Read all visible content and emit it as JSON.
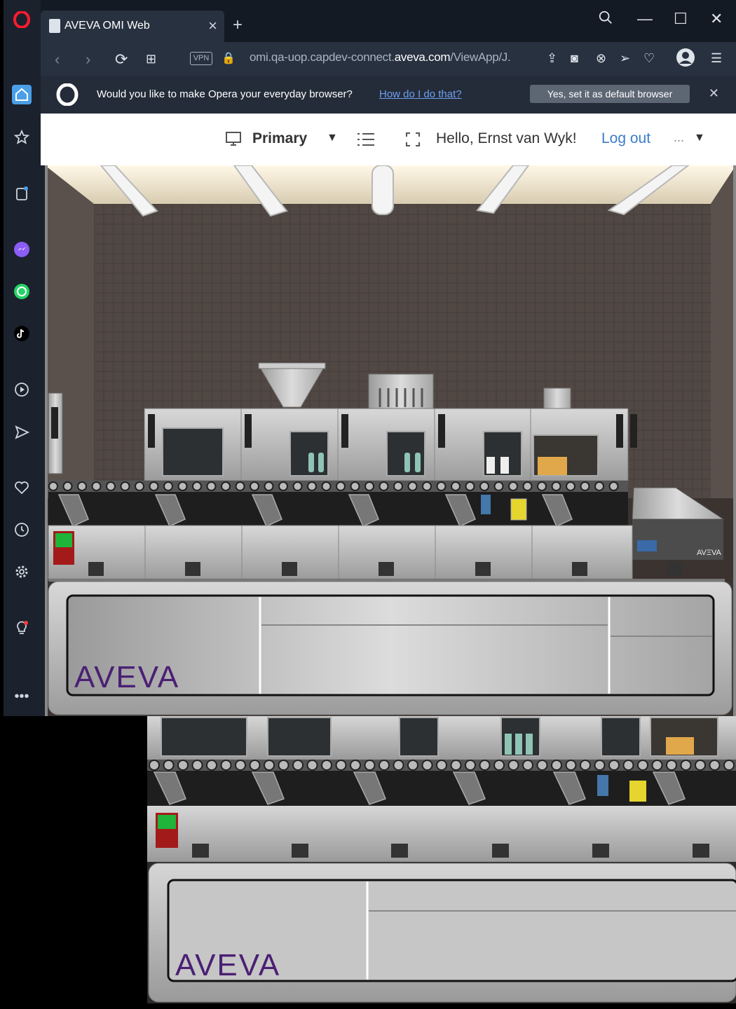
{
  "browser": {
    "tab_title": "AVEVA OMI Web",
    "url_prefix": "omi.qa-uop.capdev-connect.",
    "url_domain": "aveva.com",
    "url_suffix": "/ViewApp/J.",
    "vpn_label": "VPN",
    "banner_text": "Would you like to make Opera your everyday browser?",
    "banner_link": "How do I do that?",
    "banner_button": "Yes, set it as default browser"
  },
  "omi": {
    "screen_selector": "Primary",
    "greeting": "Hello, Ernst van Wyk!",
    "logout": "Log out",
    "more": "..."
  },
  "scene": {
    "brand": "AVEVA",
    "station_brand": "AVΞVA"
  },
  "colors": {
    "accent": "#4a9fe8",
    "brand_purple": "#4b1f74",
    "link": "#3b7cc9"
  }
}
